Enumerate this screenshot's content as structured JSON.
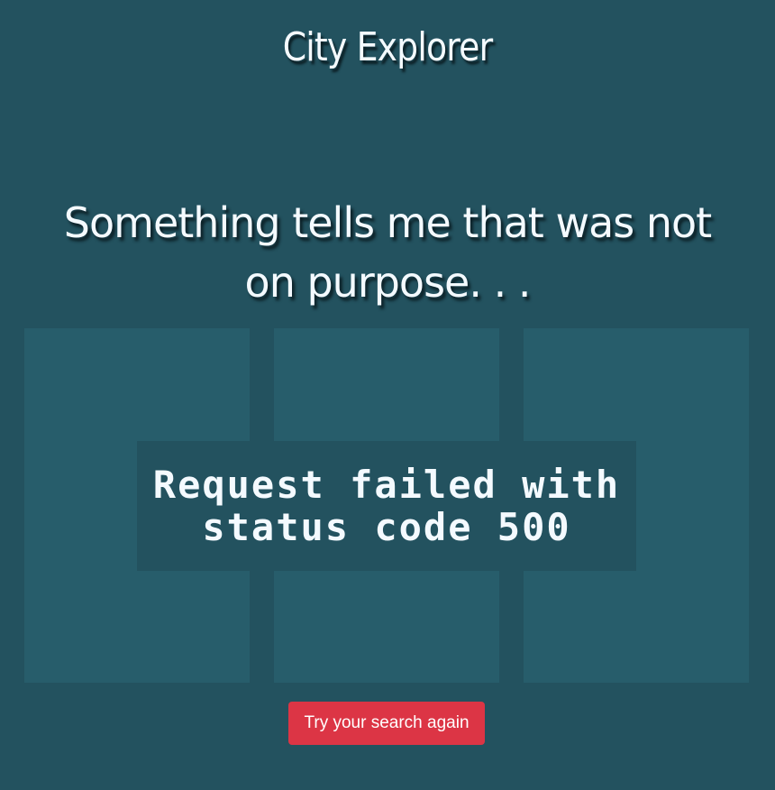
{
  "app": {
    "title": "City Explorer"
  },
  "error": {
    "heading": "Something tells me that was not on purpose. . .",
    "message": "Request failed with status code 500"
  },
  "actions": {
    "retry_label": "Try your search again"
  },
  "colors": {
    "background": "#23525f",
    "panel": "#275d6b",
    "text": "#f4faff",
    "button": "#dc3545"
  }
}
